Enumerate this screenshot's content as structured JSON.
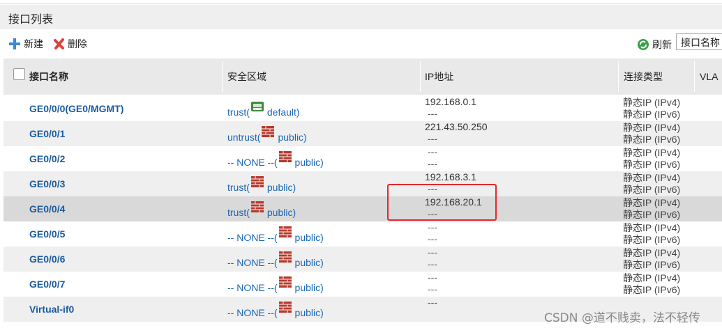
{
  "page": {
    "title": "接口列表"
  },
  "toolbar": {
    "new_label": "新建",
    "delete_label": "删除",
    "refresh_label": "刷新",
    "search_placeholder": "接口名称"
  },
  "table": {
    "columns": [
      "接口名称",
      "安全区域",
      "IP地址",
      "连接类型",
      "VLA"
    ],
    "rows": [
      {
        "name": "GE0/0/0(GE0/MGMT)",
        "zone_prefix": "trust(",
        "zone_name": "default)",
        "ip_line1": "192.168.0.1",
        "ip_line2": "---",
        "conn_line1": "静态IP (IPv4)",
        "conn_line2": "静态IP (IPv6)",
        "zone_icon": "router-icon"
      },
      {
        "name": "GE0/0/1",
        "zone_prefix": "untrust(",
        "zone_name": "public)",
        "ip_line1": "221.43.50.250",
        "ip_line2": "---",
        "conn_line1": "静态IP (IPv4)",
        "conn_line2": "静态IP (IPv6)",
        "zone_icon": "firewall-icon"
      },
      {
        "name": "GE0/0/2",
        "zone_prefix": "-- NONE --(",
        "zone_name": "public)",
        "ip_line1": "---",
        "ip_line2": "---",
        "conn_line1": "静态IP (IPv4)",
        "conn_line2": "静态IP (IPv6)",
        "zone_icon": "firewall-icon"
      },
      {
        "name": "GE0/0/3",
        "zone_prefix": "trust(",
        "zone_name": "public)",
        "ip_line1": "192.168.3.1",
        "ip_line2": "---",
        "conn_line1": "静态IP (IPv4)",
        "conn_line2": "静态IP (IPv6)",
        "zone_icon": "firewall-icon"
      },
      {
        "name": "GE0/0/4",
        "zone_prefix": "trust(",
        "zone_name": "public)",
        "ip_line1": "192.168.20.1",
        "ip_line2": "---",
        "conn_line1": "静态IP (IPv4)",
        "conn_line2": "静态IP (IPv6)",
        "zone_icon": "firewall-icon"
      },
      {
        "name": "GE0/0/5",
        "zone_prefix": "-- NONE --(",
        "zone_name": "public)",
        "ip_line1": "---",
        "ip_line2": "---",
        "conn_line1": "静态IP (IPv4)",
        "conn_line2": "静态IP (IPv6)",
        "zone_icon": "firewall-icon"
      },
      {
        "name": "GE0/0/6",
        "zone_prefix": "-- NONE --(",
        "zone_name": "public)",
        "ip_line1": "---",
        "ip_line2": "---",
        "conn_line1": "静态IP (IPv4)",
        "conn_line2": "静态IP (IPv6)",
        "zone_icon": "firewall-icon"
      },
      {
        "name": "GE0/0/7",
        "zone_prefix": "-- NONE --(",
        "zone_name": "public)",
        "ip_line1": "---",
        "ip_line2": "---",
        "conn_line1": "静态IP (IPv4)",
        "conn_line2": "静态IP (IPv6)",
        "zone_icon": "firewall-icon"
      },
      {
        "name": "Virtual-if0",
        "zone_prefix": "-- NONE --(",
        "zone_name": "public)",
        "ip_line1": "---",
        "ip_line2": "",
        "conn_line1": "",
        "conn_line2": "",
        "zone_icon": "firewall-icon"
      }
    ]
  },
  "watermark": "CSDN @道不贱卖，法不轻传",
  "colors": {
    "accent_link": "#1a66b3",
    "highlight_box": "#e8262c",
    "selected_row": "#d9d9d9"
  }
}
